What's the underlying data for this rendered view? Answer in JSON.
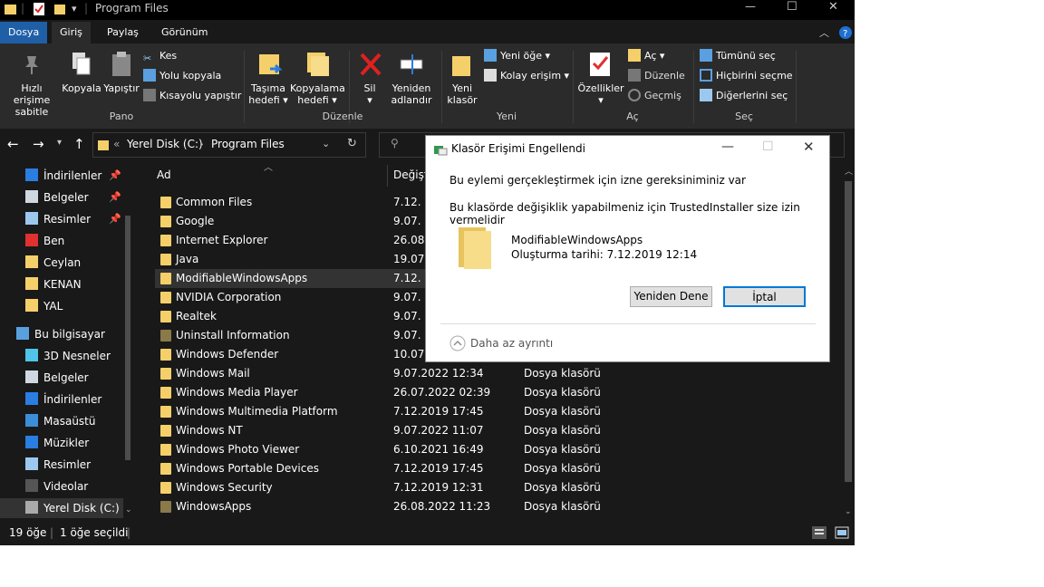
{
  "window": {
    "title": "Program Files",
    "controls": {
      "minimize": "—",
      "maximize": "☐",
      "close": "✕"
    }
  },
  "ribbon_tabs": [
    "Dosya",
    "Giriş",
    "Paylaş",
    "Görünüm"
  ],
  "ribbon": {
    "pano": {
      "group_label": "Pano",
      "pin_label_1": "Hızlı erişime",
      "pin_label_2": "sabitle",
      "copy": "Kopyala",
      "paste": "Yapıştır",
      "cut": "Kes",
      "copy_path": "Yolu kopyala",
      "paste_shortcut": "Kısayolu yapıştır"
    },
    "duzenle": {
      "group_label": "Düzenle",
      "move_1": "Taşıma",
      "move_2": "hedefi ▾",
      "copyto_1": "Kopyalama",
      "copyto_2": "hedefi ▾",
      "delete_1": "Sil",
      "delete_2": "▾",
      "rename_1": "Yeniden",
      "rename_2": "adlandır"
    },
    "yeni": {
      "group_label": "Yeni",
      "newfolder_1": "Yeni",
      "newfolder_2": "klasör",
      "new_item": "Yeni öğe ▾",
      "easy_access": "Kolay erişim ▾"
    },
    "ac": {
      "group_label": "Aç",
      "properties": "Özellikler",
      "properties_2": "▾",
      "open": "Aç ▾",
      "edit": "Düzenle",
      "history": "Geçmiş"
    },
    "sec": {
      "group_label": "Seç",
      "select_all": "Tümünü seç",
      "select_none": "Hiçbirini seçme",
      "invert": "Diğerlerini seç"
    }
  },
  "address": {
    "prefix": "«",
    "segment_1": "Yerel Disk (C:)",
    "sep": "›",
    "segment_2": "Program Files"
  },
  "nav": {
    "quick": [
      {
        "label": "İndirilenler",
        "icon": "download-icon",
        "pinned": true
      },
      {
        "label": "Belgeler",
        "icon": "documents-icon",
        "pinned": true
      },
      {
        "label": "Resimler",
        "icon": "pictures-icon",
        "pinned": true
      },
      {
        "label": "Ben",
        "icon": "blocked-icon",
        "pinned": false
      },
      {
        "label": "Ceylan",
        "icon": "folder-icon",
        "pinned": false
      },
      {
        "label": "KENAN",
        "icon": "folder-icon",
        "pinned": false
      },
      {
        "label": "YAL",
        "icon": "folder-icon",
        "pinned": false
      }
    ],
    "this_pc": "Bu bilgisayar",
    "pc_items": [
      {
        "label": "3D Nesneler",
        "icon": "cube-icon"
      },
      {
        "label": "Belgeler",
        "icon": "documents-icon"
      },
      {
        "label": "İndirilenler",
        "icon": "download-icon"
      },
      {
        "label": "Masaüstü",
        "icon": "desktop-icon"
      },
      {
        "label": "Müzikler",
        "icon": "music-icon"
      },
      {
        "label": "Resimler",
        "icon": "pictures-icon"
      },
      {
        "label": "Videolar",
        "icon": "video-icon"
      },
      {
        "label": "Yerel Disk (C:)",
        "icon": "drive-icon"
      }
    ]
  },
  "list": {
    "col_name": "Ad",
    "col_date": "Değiştirme tarihi",
    "col_date_visible": "Değişt",
    "rows": [
      {
        "name": "Common Files",
        "date": "7.12.",
        "type": ""
      },
      {
        "name": "Google",
        "date": "9.07.",
        "type": ""
      },
      {
        "name": "Internet Explorer",
        "date": "26.08.",
        "type": ""
      },
      {
        "name": "Java",
        "date": "19.07.",
        "type": ""
      },
      {
        "name": "ModifiableWindowsApps",
        "date": "7.12.",
        "type": ""
      },
      {
        "name": "NVIDIA Corporation",
        "date": "9.07.",
        "type": ""
      },
      {
        "name": "Realtek",
        "date": "9.07.",
        "type": ""
      },
      {
        "name": "Uninstall Information",
        "date": "9.07.",
        "type": ""
      },
      {
        "name": "Windows Defender",
        "date": "10.07.",
        "type": ""
      },
      {
        "name": "Windows Mail",
        "date": "9.07.2022 12:34",
        "type": "Dosya klasörü"
      },
      {
        "name": "Windows Media Player",
        "date": "26.07.2022 02:39",
        "type": "Dosya klasörü"
      },
      {
        "name": "Windows Multimedia Platform",
        "date": "7.12.2019 17:45",
        "type": "Dosya klasörü"
      },
      {
        "name": "Windows NT",
        "date": "9.07.2022 11:07",
        "type": "Dosya klasörü"
      },
      {
        "name": "Windows Photo Viewer",
        "date": "6.10.2021 16:49",
        "type": "Dosya klasörü"
      },
      {
        "name": "Windows Portable Devices",
        "date": "7.12.2019 17:45",
        "type": "Dosya klasörü"
      },
      {
        "name": "Windows Security",
        "date": "7.12.2019 12:31",
        "type": "Dosya klasörü"
      },
      {
        "name": "WindowsApps",
        "date": "26.08.2022 11:23",
        "type": "Dosya klasörü"
      }
    ]
  },
  "status": {
    "count": "19 öğe",
    "selected": "1 öğe seçildi"
  },
  "dialog": {
    "title": "Klasör Erişimi Engellendi",
    "line1": "Bu eylemi gerçekleştirmek için izne gereksiniminiz var",
    "line2": "Bu klasörde değişiklik yapabilmeniz için TrustedInstaller size izin vermelidir",
    "folder_name": "ModifiableWindowsApps",
    "folder_created": "Oluşturma tarihi: 7.12.2019 12:14",
    "retry": "Yeniden Dene",
    "cancel": "İptal",
    "less_details": "Daha az ayrıntı"
  },
  "colors": {
    "accent": "#1f5fa8",
    "background": "#191919",
    "folder": "#f5d06a"
  }
}
